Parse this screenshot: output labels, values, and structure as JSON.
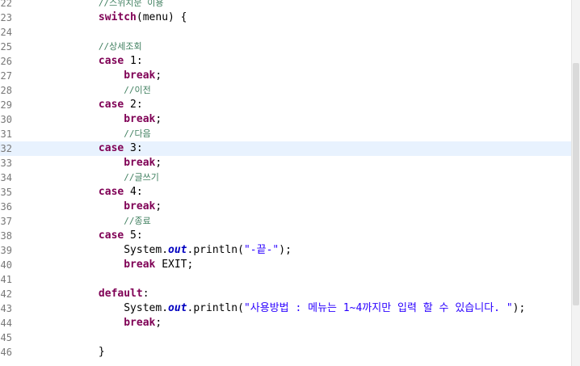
{
  "editor": {
    "current_line_number": "32",
    "lines": [
      {
        "num": "22",
        "indent": "            ",
        "tokens": [
          {
            "t": "cm",
            "v": "//스위치문 이용"
          }
        ]
      },
      {
        "num": "23",
        "indent": "            ",
        "tokens": [
          {
            "t": "kw",
            "v": "switch"
          },
          {
            "t": "tx",
            "v": "(menu) {"
          }
        ]
      },
      {
        "num": "24",
        "indent": "",
        "tokens": []
      },
      {
        "num": "25",
        "indent": "            ",
        "tokens": [
          {
            "t": "cm",
            "v": "//상세조회"
          }
        ]
      },
      {
        "num": "26",
        "indent": "            ",
        "tokens": [
          {
            "t": "kw",
            "v": "case"
          },
          {
            "t": "tx",
            "v": " 1:"
          }
        ]
      },
      {
        "num": "27",
        "indent": "                ",
        "tokens": [
          {
            "t": "kw",
            "v": "break"
          },
          {
            "t": "tx",
            "v": ";"
          }
        ]
      },
      {
        "num": "28",
        "indent": "                ",
        "tokens": [
          {
            "t": "cm",
            "v": "//이전"
          }
        ]
      },
      {
        "num": "29",
        "indent": "            ",
        "tokens": [
          {
            "t": "kw",
            "v": "case"
          },
          {
            "t": "tx",
            "v": " 2:"
          }
        ]
      },
      {
        "num": "30",
        "indent": "                ",
        "tokens": [
          {
            "t": "kw",
            "v": "break"
          },
          {
            "t": "tx",
            "v": ";"
          }
        ]
      },
      {
        "num": "31",
        "indent": "                ",
        "tokens": [
          {
            "t": "cm",
            "v": "//다음"
          }
        ]
      },
      {
        "num": "32",
        "indent": "            ",
        "tokens": [
          {
            "t": "kw",
            "v": "case"
          },
          {
            "t": "tx",
            "v": " 3:"
          }
        ]
      },
      {
        "num": "33",
        "indent": "                ",
        "tokens": [
          {
            "t": "kw",
            "v": "break"
          },
          {
            "t": "tx",
            "v": ";"
          }
        ]
      },
      {
        "num": "34",
        "indent": "                ",
        "tokens": [
          {
            "t": "cm",
            "v": "//글쓰기"
          }
        ]
      },
      {
        "num": "35",
        "indent": "            ",
        "tokens": [
          {
            "t": "kw",
            "v": "case"
          },
          {
            "t": "tx",
            "v": " 4:"
          }
        ]
      },
      {
        "num": "36",
        "indent": "                ",
        "tokens": [
          {
            "t": "kw",
            "v": "break"
          },
          {
            "t": "tx",
            "v": ";"
          }
        ]
      },
      {
        "num": "37",
        "indent": "                ",
        "tokens": [
          {
            "t": "cm",
            "v": "//종료"
          }
        ]
      },
      {
        "num": "38",
        "indent": "            ",
        "tokens": [
          {
            "t": "kw",
            "v": "case"
          },
          {
            "t": "tx",
            "v": " 5:"
          }
        ]
      },
      {
        "num": "39",
        "indent": "                ",
        "tokens": [
          {
            "t": "tx",
            "v": "System."
          },
          {
            "t": "fld",
            "v": "out"
          },
          {
            "t": "tx",
            "v": ".println("
          },
          {
            "t": "str",
            "v": "\"-끝-\""
          },
          {
            "t": "tx",
            "v": ");"
          }
        ]
      },
      {
        "num": "40",
        "indent": "                ",
        "tokens": [
          {
            "t": "kw",
            "v": "break"
          },
          {
            "t": "tx",
            "v": " EXIT;"
          }
        ]
      },
      {
        "num": "41",
        "indent": "",
        "tokens": []
      },
      {
        "num": "42",
        "indent": "            ",
        "tokens": [
          {
            "t": "kw",
            "v": "default"
          },
          {
            "t": "tx",
            "v": ":"
          }
        ]
      },
      {
        "num": "43",
        "indent": "                ",
        "tokens": [
          {
            "t": "tx",
            "v": "System."
          },
          {
            "t": "fld",
            "v": "out"
          },
          {
            "t": "tx",
            "v": ".println("
          },
          {
            "t": "str",
            "v": "\"사용방법 : 메뉴는 1~4까지만 입력 할 수 있습니다. \""
          },
          {
            "t": "tx",
            "v": ");"
          }
        ]
      },
      {
        "num": "44",
        "indent": "                ",
        "tokens": [
          {
            "t": "kw",
            "v": "break"
          },
          {
            "t": "tx",
            "v": ";"
          }
        ]
      },
      {
        "num": "45",
        "indent": "",
        "tokens": []
      },
      {
        "num": "46",
        "indent": "            ",
        "tokens": [
          {
            "t": "tx",
            "v": "}"
          }
        ]
      }
    ]
  },
  "colors": {
    "keyword": "#7f0055",
    "comment": "#3f7f5f",
    "static_field": "#0000c0",
    "string": "#2a00ff",
    "line_number": "#787878",
    "current_line_bg": "#e8f2fe"
  }
}
